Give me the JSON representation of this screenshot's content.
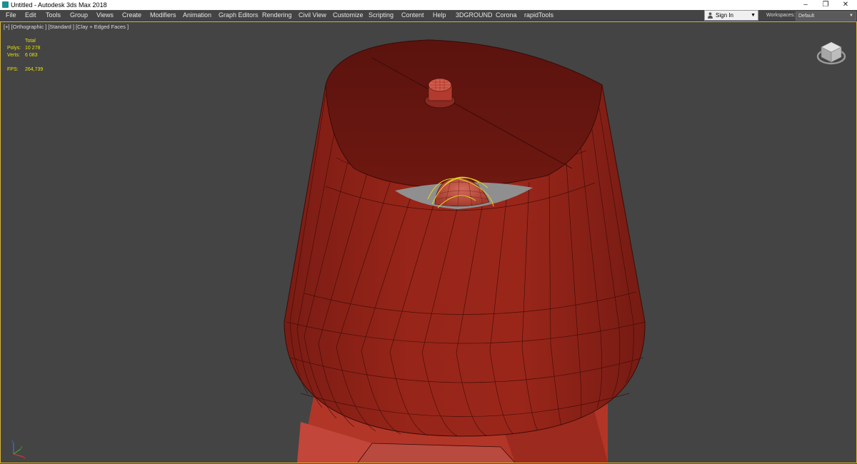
{
  "window": {
    "title": "Untitled - Autodesk 3ds Max 2018",
    "controls": {
      "minimize": "–",
      "restore": "❐",
      "close": "✕"
    }
  },
  "menu": [
    "File",
    "Edit",
    "Tools",
    "Group",
    "Views",
    "Create",
    "Modifiers",
    "Animation",
    "Graph Editors",
    "Rendering",
    "Civil View",
    "Customize",
    "Scripting",
    "Content",
    "Help",
    "3DGROUND",
    "Corona",
    "rapidTools"
  ],
  "account": {
    "sign_in_label": "Sign In",
    "dropdown_glyph": "▼"
  },
  "workspaces": {
    "label": "Workspaces:",
    "value": "Default",
    "dropdown_glyph": "▼"
  },
  "viewport": {
    "label": "[+] [Orthographic ] [Standard ] [Clay + Edged Faces ]",
    "stats": {
      "header": "Total",
      "polys_label": "Polys:",
      "polys_value": "10 278",
      "verts_label": "Verts:",
      "verts_value": "6 083",
      "fps_label": "FPS:",
      "fps_value": "264,739"
    }
  },
  "colors": {
    "viewport_bg": "#444444",
    "active_border": "#d7b63a",
    "clay_red": "#8e2218",
    "clay_red_dark": "#5a130e",
    "wire_edge": "#3a0b07",
    "selection_curves": "#e6d320",
    "stats_text": "#e8e000"
  }
}
